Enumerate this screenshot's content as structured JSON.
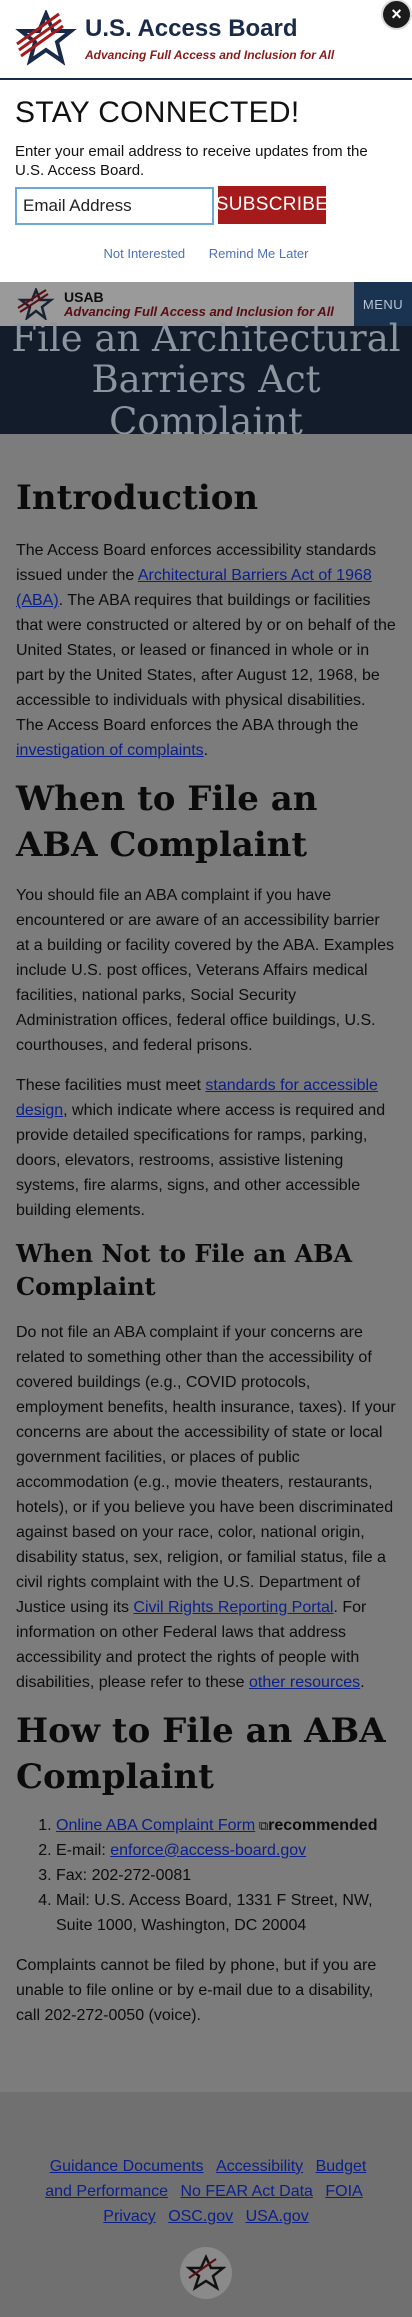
{
  "modal": {
    "site_name": "U.S. Access Board",
    "tagline": "Advancing Full Access and Inclusion for All",
    "close_label": "×",
    "title": "STAY CONNECTED!",
    "description": "Enter your email address to receive updates from the U.S. Access Board.",
    "email_placeholder": "Email Address",
    "subscribe_label": "SUBSCRIBE",
    "not_interested_label": "Not Interested",
    "remind_label": "Remind Me Later"
  },
  "header": {
    "short_name": "USAB",
    "tagline": "Advancing Full Access and Inclusion for All",
    "menu_label": "MENU"
  },
  "banner": {
    "line1": "File an Architectural",
    "line2": "Barriers Act Complaint"
  },
  "intro": {
    "heading": "Introduction",
    "p1_a": "The Access Board enforces accessibility standards issued under the ",
    "p1_link": "Architectural Barriers Act of 1968 (ABA)",
    "p1_b": ". The ABA requires that buildings or facilities that were constructed or altered by or on behalf of the United States, or leased or financed in whole or in part by the United States, after August 12, 1968, be accessible to individuals with physical disabilities. The Access Board enforces the ABA through the ",
    "p1_link2": "investigation of complaints",
    "p1_c": "."
  },
  "when": {
    "heading": "When to File an ABA Complaint",
    "p1": "You should file an ABA complaint if you have encountered or are aware of an accessibility barrier at a building or facility covered by the ABA. Examples include U.S. post offices, Veterans Affairs medical facilities, national parks, Social Security Administration offices, federal office buildings, U.S. courthouses, and federal prisons.",
    "p2_a": "These facilities must meet ",
    "p2_link": "standards for accessible design",
    "p2_b": ", which indicate where access is required and provide detailed specifications for ramps, parking, doors, elevators, restrooms, assistive listening systems, fire alarms, signs, and other accessible building elements."
  },
  "when_not": {
    "heading": "When Not to File an ABA Complaint",
    "p_a": "Do not file an ABA complaint if your concerns are related to something other than the accessibility of covered buildings (e.g., COVID protocols, employment benefits, health insurance, taxes). If your concerns are about the accessibility of state or local government facilities, or places of public accommodation (e.g., movie theaters, restaurants, hotels), or if you believe you have been discriminated against based on your race, color, national origin, disability status, sex, religion, or familial status, file a civil rights complaint with the U.S. Department of Justice using its ",
    "p_link": "Civil Rights Reporting Portal",
    "p_b": ". For information on other Federal laws that address accessibility and protect the rights of people with disabilities, please refer to these ",
    "p_link2": "other resources",
    "p_c": "."
  },
  "how": {
    "heading": "How to File an ABA Complaint",
    "item1_link": "Online ABA Complaint Form",
    "item1_icon": "external-link-icon",
    "item1_note": "recommended",
    "item2_label": "E-mail: ",
    "item2_link": "enforce@access-board.gov",
    "item3": "Fax: 202-272-0081",
    "item4": "Mail: U.S. Access Board, 1331 F Street, NW, Suite 1000, Washington, DC 20004",
    "closing": "Complaints cannot be filed by phone, but if you are unable to file online or by e-mail due to a disability, call 202-272-0050 (voice)."
  },
  "footer": {
    "links": [
      "Guidance Documents",
      "Accessibility",
      "Budget and Performance",
      "No FEAR Act Data",
      "FOIA",
      "Privacy",
      "OSC.gov",
      "USA.gov"
    ]
  },
  "colors": {
    "navy": "#1a2a4a",
    "brand_red": "#a51b1b",
    "overlay_gray": "#7d7d7d"
  }
}
